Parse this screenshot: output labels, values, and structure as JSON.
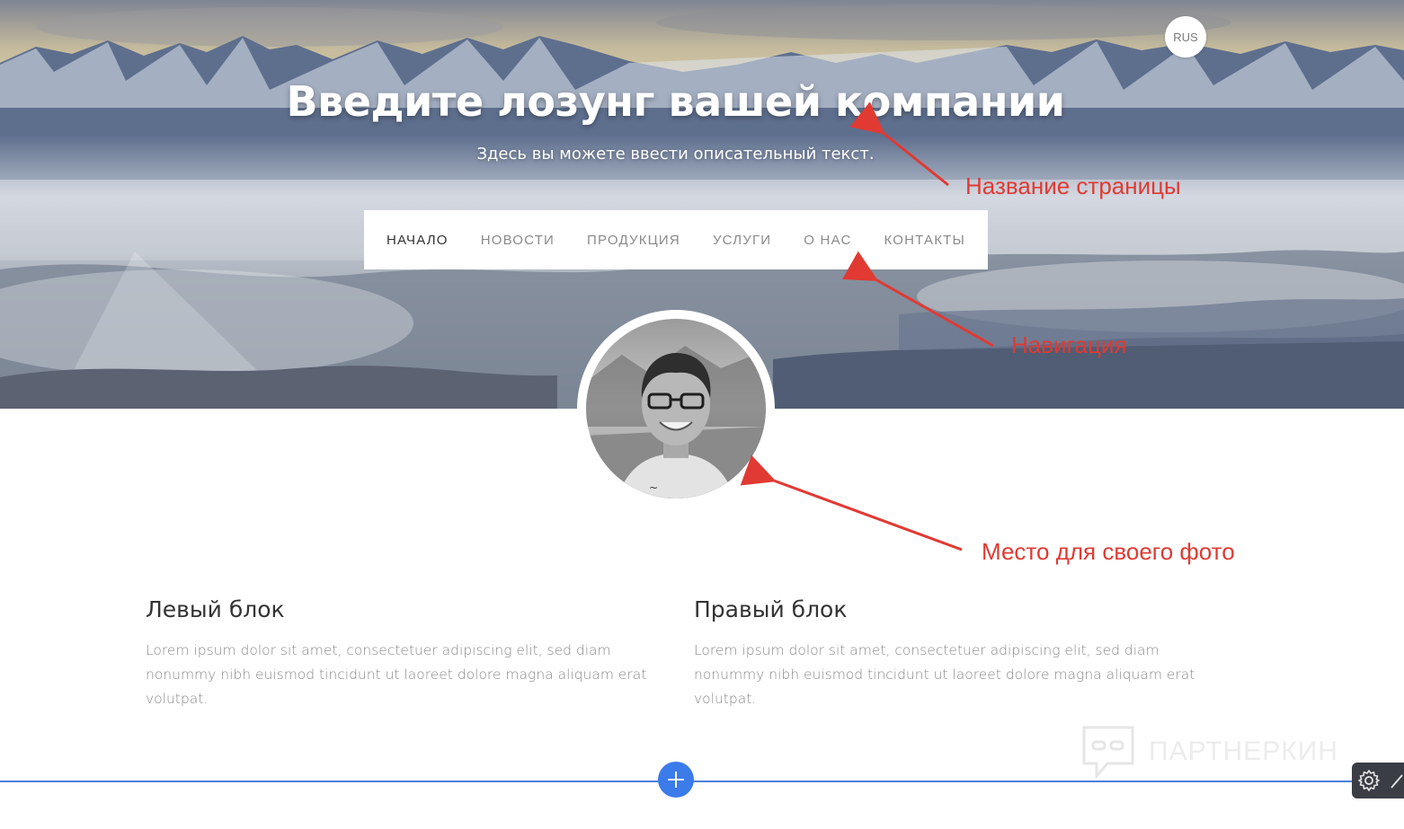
{
  "header": {
    "lang_label": "RUS",
    "title": "Введите лозунг вашей компании",
    "subtitle": "Здесь вы можете ввести описательный текст."
  },
  "nav": {
    "items": [
      {
        "label": "НАЧАЛО",
        "active": true
      },
      {
        "label": "НОВОСТИ",
        "active": false
      },
      {
        "label": "ПРОДУКЦИЯ",
        "active": false
      },
      {
        "label": "УСЛУГИ",
        "active": false
      },
      {
        "label": "О НАС",
        "active": false
      },
      {
        "label": "КОНТАКТЫ",
        "active": false
      }
    ]
  },
  "annotations": {
    "page_name": "Название страницы",
    "navigation": "Навигация",
    "photo_place": "Место для своего фото"
  },
  "blocks": {
    "left": {
      "title": "Левый блок",
      "text": "Lorem ipsum dolor sit amet, consectetuer adipiscing elit, sed diam nonummy nibh euismod tincidunt ut laoreet dolore magna aliquam erat volutpat."
    },
    "right": {
      "title": "Правый блок",
      "text": "Lorem ipsum dolor sit amet, consectetuer adipiscing elit, sed diam nonummy nibh euismod tincidunt ut laoreet dolore magna aliquam erat volutpat."
    }
  },
  "watermark": {
    "text": "ПАРТНЕРКИН"
  },
  "icons": {
    "add": "plus-icon",
    "settings": "gear-icon",
    "edit": "pencil-icon",
    "watermark": "chat-logo-icon"
  },
  "colors": {
    "accent_blue": "#3b7bea",
    "annotation_red": "#e03a33",
    "divider": "#4a7fd6"
  }
}
